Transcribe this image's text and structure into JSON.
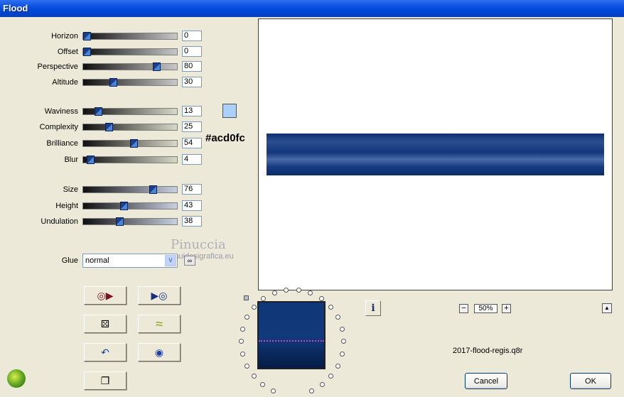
{
  "window": {
    "title": "Flood"
  },
  "sliders": [
    {
      "label": "Horizon",
      "value": "0",
      "fraction": 0.0,
      "color": "#c8c8c8"
    },
    {
      "label": "Offset",
      "value": "0",
      "fraction": 0.0,
      "color": "#c8c8c8"
    },
    {
      "label": "Perspective",
      "value": "80",
      "fraction": 0.8,
      "color": "#c8c8c8"
    },
    {
      "label": "Altitude",
      "value": "30",
      "fraction": 0.3,
      "color": "#c8c8c8"
    },
    {
      "label": "Waviness",
      "value": "13",
      "fraction": 0.13,
      "color": "#d8d8c8"
    },
    {
      "label": "Complexity",
      "value": "25",
      "fraction": 0.25,
      "color": "#d8d8c8"
    },
    {
      "label": "Brilliance",
      "value": "54",
      "fraction": 0.54,
      "color": "#d8d8c8"
    },
    {
      "label": "Blur",
      "value": "4",
      "fraction": 0.04,
      "color": "#d8d8c8"
    },
    {
      "label": "Size",
      "value": "76",
      "fraction": 0.76,
      "color": "#c8d0e0"
    },
    {
      "label": "Height",
      "value": "43",
      "fraction": 0.43,
      "color": "#c8d0e0"
    },
    {
      "label": "Undulation",
      "value": "38",
      "fraction": 0.38,
      "color": "#c8d0e0"
    }
  ],
  "color": {
    "swatch": "#acd0fc",
    "hex_label": "#acd0fc"
  },
  "watermark": {
    "line1": "Pinuccia",
    "line2": "www.mauidesigrafica.eu"
  },
  "glue": {
    "label": "Glue",
    "value": "normal"
  },
  "zoom": {
    "value": "50%"
  },
  "preset": {
    "filename": "2017-flood-regis.q8r"
  },
  "buttons": {
    "cancel": "Cancel",
    "ok": "OK",
    "info": "i"
  },
  "colors": {
    "water": "#0f3778",
    "water_light": "#4f6fa8"
  }
}
